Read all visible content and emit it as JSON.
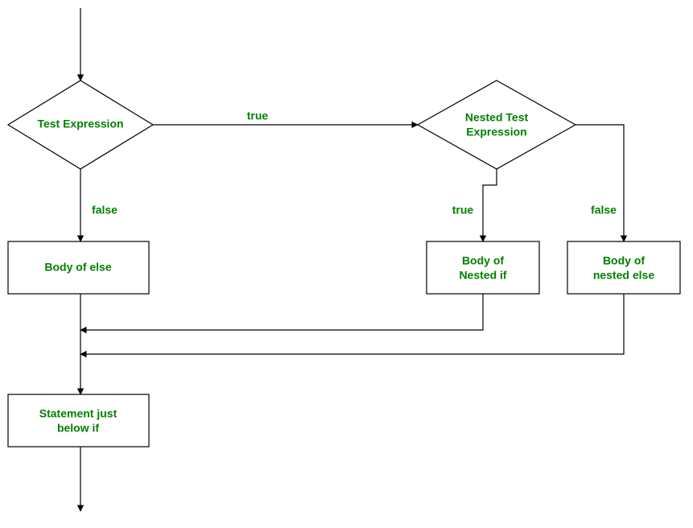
{
  "diagram": {
    "nodes": {
      "test_expr": "Test Expression",
      "nested_test_expr_l1": "Nested Test",
      "nested_test_expr_l2": "Expression",
      "body_else": "Body of else",
      "body_nested_if_l1": "Body of",
      "body_nested_if_l2": "Nested if",
      "body_nested_else_l1": "Body of",
      "body_nested_else_l2": "nested else",
      "stmt_below_l1": "Statement just",
      "stmt_below_l2": "below if"
    },
    "edges": {
      "true1": "true",
      "false1": "false",
      "true2": "true",
      "false2": "false"
    }
  }
}
